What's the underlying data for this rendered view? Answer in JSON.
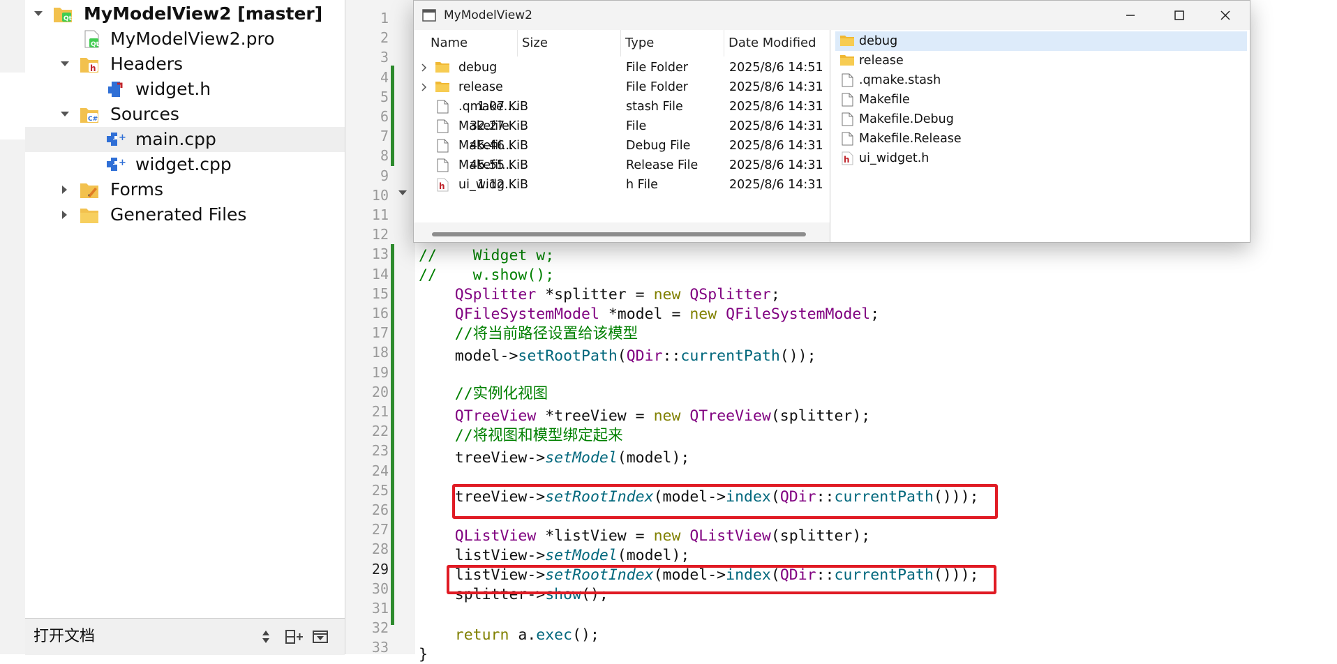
{
  "project_tree": {
    "root_label": "MyModelView2 [master]",
    "pro_file": "MyModelView2.pro",
    "headers_label": "Headers",
    "header_file": "widget.h",
    "sources_label": "Sources",
    "source_files": [
      "main.cpp",
      "widget.cpp"
    ],
    "forms_label": "Forms",
    "generated_label": "Generated Files"
  },
  "doc_bar": {
    "title": "打开文档"
  },
  "editor": {
    "line_numbers": [
      "1",
      "2",
      "3",
      "4",
      "5",
      "6",
      "7",
      "8",
      "9",
      "10",
      "11",
      "12",
      "13",
      "14",
      "15",
      "16",
      "17",
      "18",
      "19",
      "20",
      "21",
      "22",
      "23",
      "24",
      "25",
      "26",
      "27",
      "28",
      "29",
      "30",
      "31",
      "32",
      "33"
    ],
    "current_line": "29",
    "lines": {
      "l13": "//    Widget w;",
      "l14": "//    w.show();",
      "l15": [
        "QSplitter",
        " *splitter = ",
        "new",
        " ",
        "QSplitter",
        ";"
      ],
      "l16": [
        "QFileSystemModel",
        " *model = ",
        "new",
        " ",
        "QFileSystemModel",
        ";"
      ],
      "l17": "//将当前路径设置给该模型",
      "l18": [
        "model->",
        "setRootPath",
        "(",
        "QDir",
        "::",
        "currentPath",
        "());"
      ],
      "l20": "//实例化视图",
      "l21": [
        "QTreeView",
        " *treeView = ",
        "new",
        " ",
        "QTreeView",
        "(splitter);"
      ],
      "l22": "//将视图和模型绑定起来",
      "l23": [
        "treeView->",
        "setModel",
        "(model);"
      ],
      "l25": [
        "treeView->",
        "setRootIndex",
        "(model->",
        "index",
        "(",
        "QDir",
        "::",
        "currentPath",
        "()));"
      ],
      "l27": [
        "QListView",
        " *listView = ",
        "new",
        " ",
        "QListView",
        "(splitter);"
      ],
      "l28": [
        "listView->",
        "setModel",
        "(model);"
      ],
      "l29": [
        "listView->",
        "setRootIndex",
        "(model->",
        "index",
        "(",
        "QDir",
        "::",
        "currentPath",
        "()));"
      ],
      "l30": [
        "splitter->",
        "show",
        "();"
      ],
      "l32": [
        "return",
        " a.",
        "exec",
        "();"
      ],
      "l33": "}"
    }
  },
  "file_window": {
    "title": "MyModelView2",
    "columns": [
      "Name",
      "Size",
      "Type",
      "Date Modified"
    ],
    "rows": [
      {
        "name": "debug",
        "size": "",
        "type": "File Folder",
        "date": "2025/8/6 14:51",
        "icon": "folder-icon"
      },
      {
        "name": "release",
        "size": "",
        "type": "File Folder",
        "date": "2025/8/6 14:31",
        "icon": "folder-icon"
      },
      {
        "name": ".qmake....",
        "size": "1.07 KiB",
        "type": "stash File",
        "date": "2025/8/6 14:31",
        "icon": "file-icon"
      },
      {
        "name": "Makefile",
        "size": "32.27 KiB",
        "type": "File",
        "date": "2025/8/6 14:31",
        "icon": "file-icon"
      },
      {
        "name": "Makefil...",
        "size": "45.46 KiB",
        "type": "Debug File",
        "date": "2025/8/6 14:31",
        "icon": "file-icon"
      },
      {
        "name": "Makefil...",
        "size": "45.55 KiB",
        "type": "Release File",
        "date": "2025/8/6 14:31",
        "icon": "file-icon"
      },
      {
        "name": "ui_widg...",
        "size": "1.12 KiB",
        "type": "h File",
        "date": "2025/8/6 14:31",
        "icon": "header-file-icon"
      }
    ],
    "list_items": [
      {
        "name": "debug",
        "icon": "folder-icon"
      },
      {
        "name": "release",
        "icon": "folder-icon"
      },
      {
        "name": ".qmake.stash",
        "icon": "file-icon"
      },
      {
        "name": "Makefile",
        "icon": "file-icon"
      },
      {
        "name": "Makefile.Debug",
        "icon": "file-icon"
      },
      {
        "name": "Makefile.Release",
        "icon": "file-icon"
      },
      {
        "name": "ui_widget.h",
        "icon": "header-file-icon"
      }
    ]
  },
  "colors": {
    "highlight_box": "#e01b24",
    "change_bar": "#2d8b2d",
    "keyword": "#808000",
    "type": "#800080",
    "function": "#00677c",
    "comment": "#008000"
  }
}
